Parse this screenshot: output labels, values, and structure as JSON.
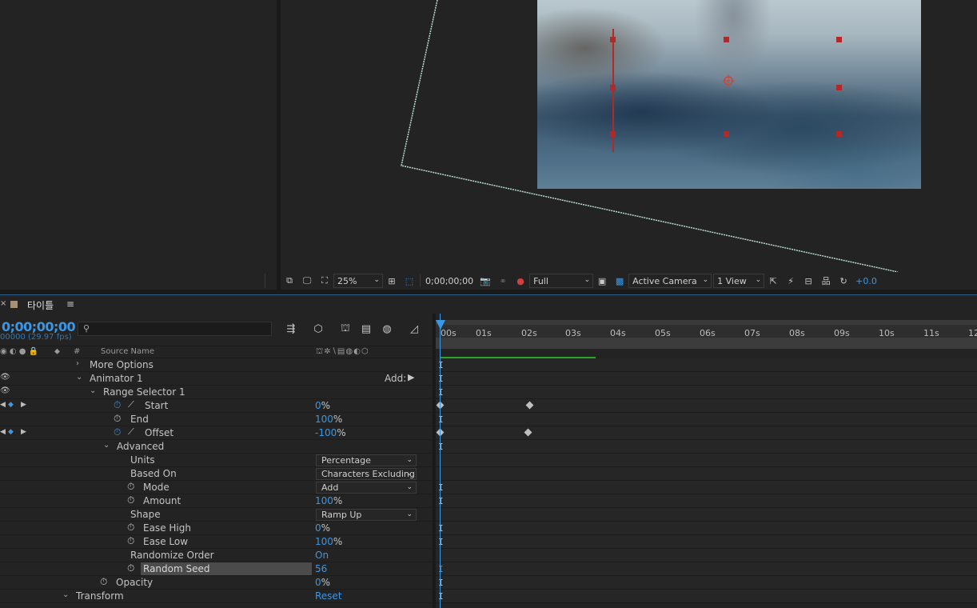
{
  "viewer": {
    "zoom": "25%",
    "timecode": "0;00;00;00",
    "resolution": "Full",
    "camera": "Active Camera",
    "view": "1 View",
    "exposure": "+0.0"
  },
  "timeline": {
    "comp_name": "타이틀",
    "timecode": "0;00;00;00",
    "fps": "00000 (29.97 fps)",
    "search_placeholder": "",
    "columns": {
      "hash": "#",
      "source_name": "Source Name"
    },
    "ruler_labels": [
      "00s",
      "01s",
      "02s",
      "03s",
      "04s",
      "05s",
      "06s",
      "07s",
      "08s",
      "09s",
      "10s",
      "11s",
      "12"
    ],
    "rows": [
      {
        "label": "More Options"
      },
      {
        "label": "Animator 1",
        "add": "Add:"
      },
      {
        "label": "Range Selector 1"
      },
      {
        "label": "Start",
        "value": "0",
        "unit": "%"
      },
      {
        "label": "End",
        "value": "100",
        "unit": "%"
      },
      {
        "label": "Offset",
        "value": "-100",
        "unit": "%"
      },
      {
        "label": "Advanced"
      },
      {
        "label": "Units",
        "dropdown": "Percentage"
      },
      {
        "label": "Based On",
        "dropdown": "Characters Excluding"
      },
      {
        "label": "Mode",
        "dropdown": "Add"
      },
      {
        "label": "Amount",
        "value": "100",
        "unit": "%"
      },
      {
        "label": "Shape",
        "dropdown": "Ramp Up"
      },
      {
        "label": "Ease High",
        "value": "0",
        "unit": "%"
      },
      {
        "label": "Ease Low",
        "value": "100",
        "unit": "%"
      },
      {
        "label": "Randomize Order",
        "value": "On"
      },
      {
        "label": "Random Seed",
        "value": "56"
      },
      {
        "label": "Opacity",
        "value": "0",
        "unit": "%"
      },
      {
        "label": "Transform",
        "value": "Reset"
      }
    ]
  },
  "colors": {
    "accent": "#3a97e6",
    "handle": "#b02a2a",
    "work_bar": "#2aa52a"
  }
}
